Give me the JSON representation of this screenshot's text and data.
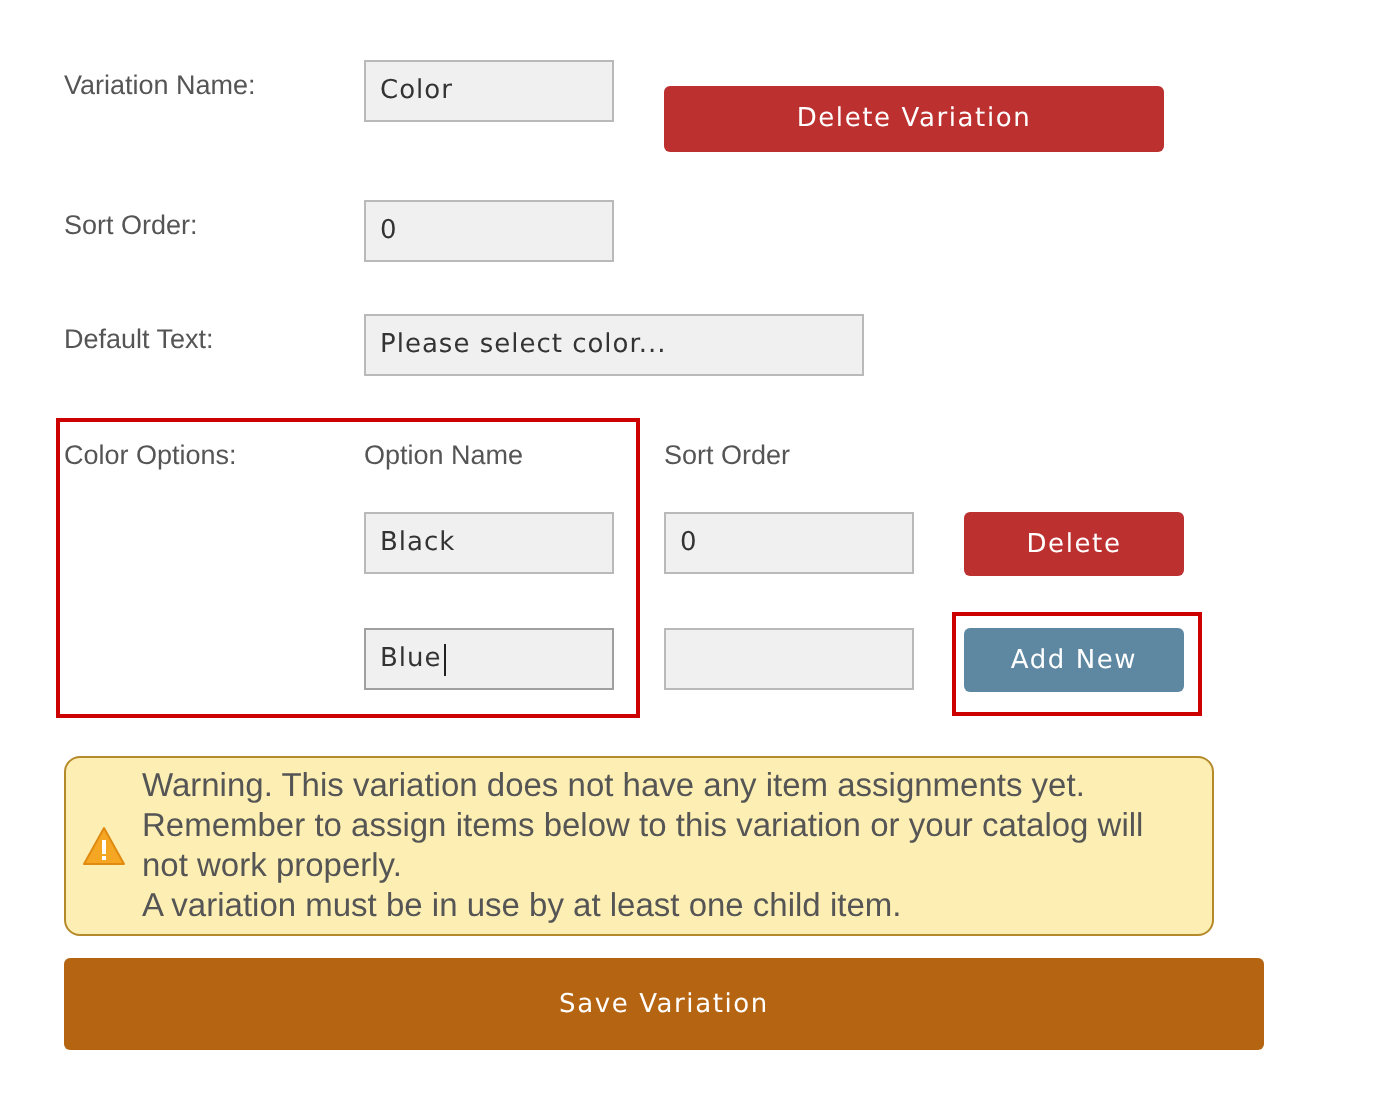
{
  "fields": [
    {
      "label": "Variation Name:",
      "value": "Color",
      "kind": "text"
    },
    {
      "label": "Sort Order:",
      "value": "0",
      "kind": "text"
    },
    {
      "label": "Default Text:",
      "value": "Please select color...",
      "kind": "wide"
    }
  ],
  "delete_variation_button": "Delete Variation",
  "options": {
    "label": "Color Options:",
    "name_header": "Option Name",
    "sort_header": "Sort Order",
    "rows": [
      {
        "kind": "existing",
        "name": "Black",
        "sort_order": "0",
        "focused": false,
        "button": "Delete"
      },
      {
        "kind": "new",
        "name": "Blue",
        "focused": true,
        "button": "Add New"
      }
    ]
  },
  "warning": {
    "lines": [
      "Warning. This variation does not have any item assignments yet.",
      "Remember to assign items below to this variation or your catalog will not work properly.",
      "A variation must be in use by at least one child item."
    ]
  },
  "save_button": "Save Variation"
}
